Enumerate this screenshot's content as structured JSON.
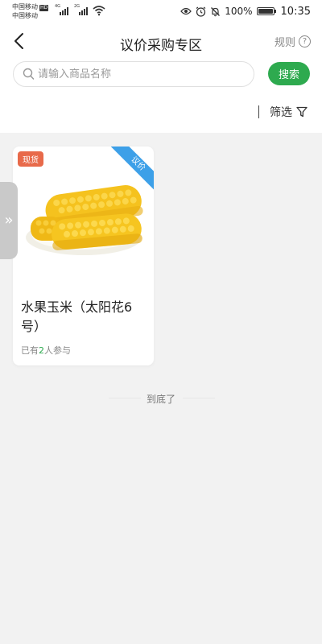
{
  "status_bar": {
    "carrier_1": "中国移动",
    "carrier_1_badge": "HD",
    "carrier_2": "中国移动",
    "network_1": "4G",
    "network_2": "2G",
    "battery_percent": "100%",
    "battery_level": 1.0,
    "time": "10:35"
  },
  "header": {
    "title": "议价采购专区",
    "rules_label": "规则",
    "help_icon_glyph": "?"
  },
  "search": {
    "placeholder": "请输入商品名称",
    "button_label": "搜索"
  },
  "filter": {
    "label": "筛选"
  },
  "colors": {
    "accent_green": "#2eaa4f",
    "spot_tag_bg": "#e86a4a",
    "ribbon_bg": "#3da0e8",
    "page_bg": "#f2f2f2"
  },
  "products": [
    {
      "tag": "现货",
      "ribbon": "议价",
      "name": "水果玉米（太阳花6号）",
      "participants_prefix": "已有",
      "participants_count": "2",
      "participants_suffix": "人参与",
      "image": "corn-image"
    }
  ],
  "side_tab": {
    "icon": "double-chevron-right-icon",
    "glyph": "»"
  },
  "footer": {
    "end_text": "到底了"
  }
}
